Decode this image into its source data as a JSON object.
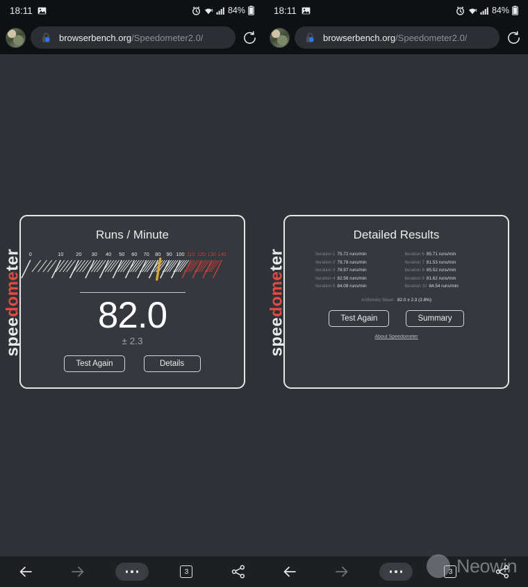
{
  "status_bar": {
    "time": "18:11",
    "battery_percent": "84%",
    "icons": [
      "image-icon",
      "alarm-icon",
      "wifi-icon",
      "signal-icon",
      "battery-icon"
    ]
  },
  "browser": {
    "url_domain": "browserbench.org",
    "url_path": "/Speedometer2.0/",
    "reload_label": "reload-icon",
    "avatar_label": "profile-avatar"
  },
  "bottom_nav": {
    "back_label": "back-arrow-icon",
    "forward_label": "forward-arrow-icon",
    "menu_label": "more-menu-icon",
    "tab_count": "3",
    "share_label": "share-icon"
  },
  "watermark": {
    "text": "Neowin"
  },
  "logo": {
    "prefix": "spee",
    "accent": "dome",
    "suffix": "ter"
  },
  "gauge_card": {
    "title": "Runs / Minute",
    "score": "82.0",
    "deviation": "± 2.3",
    "buttons": [
      {
        "label": "Test Again",
        "name": "test-again-button"
      },
      {
        "label": "Details",
        "name": "details-button"
      }
    ]
  },
  "results_card": {
    "title": "Detailed Results",
    "iterations": [
      {
        "label": "Iteration 1",
        "value": "75.72 runs/min"
      },
      {
        "label": "Iteration 6",
        "value": "85.71 runs/min"
      },
      {
        "label": "Iteration 2",
        "value": "79.78 runs/min"
      },
      {
        "label": "Iteration 7",
        "value": "81.53 runs/min"
      },
      {
        "label": "Iteration 3",
        "value": "78.97 runs/min"
      },
      {
        "label": "Iteration 8",
        "value": "85.52 runs/min"
      },
      {
        "label": "Iteration 4",
        "value": "82.56 runs/min"
      },
      {
        "label": "Iteration 9",
        "value": "81.62 runs/min"
      },
      {
        "label": "Iteration 5",
        "value": "84.08 runs/min"
      },
      {
        "label": "Iteration 10",
        "value": "84.54 runs/min"
      }
    ],
    "mean_label": "Arithmetic Mean:",
    "mean_value": "82.0 ± 2.3 (2.8%)",
    "buttons": [
      {
        "label": "Test Again",
        "name": "test-again-button"
      },
      {
        "label": "Summary",
        "name": "summary-button"
      }
    ],
    "about_link": "About Speedometer"
  },
  "chart_data": {
    "type": "gauge",
    "title": "Runs / Minute",
    "value": 82.0,
    "error": 2.3,
    "tick_labels": [
      "0",
      "10",
      "20",
      "30",
      "40",
      "50",
      "60",
      "70",
      "80",
      "90",
      "100",
      "110",
      "120",
      "130",
      "140"
    ],
    "range_min": 0,
    "range_max": 140,
    "redline_start": 110,
    "needle_color": "#d8a838",
    "tick_color": "#e8e9eb",
    "redline_color": "#c0403c",
    "samples": [
      75.72,
      79.78,
      78.97,
      82.56,
      84.08,
      85.71,
      81.53,
      85.52,
      81.62,
      84.54
    ]
  },
  "colors": {
    "page_bg": "#2f3237",
    "card_bg": "#35383d",
    "chrome_bg": "#0e1012",
    "nav_bg": "#1d1f23",
    "accent_red": "#e24b44"
  }
}
